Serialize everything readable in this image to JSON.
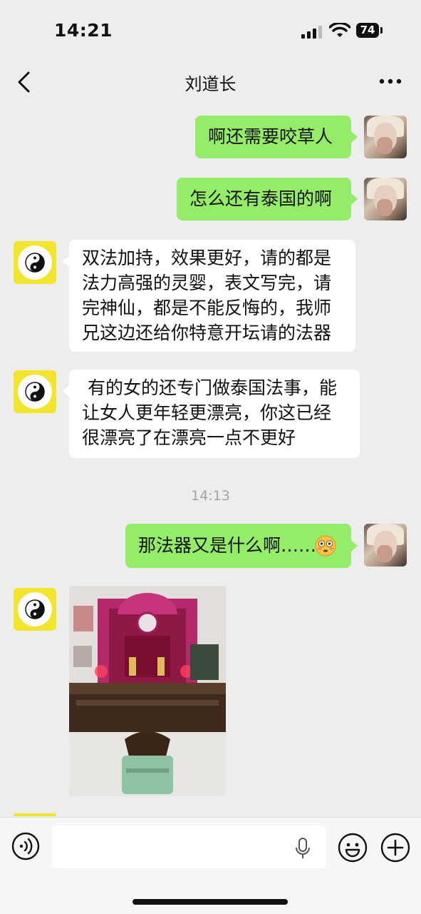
{
  "status_bar": {
    "time": "14:21",
    "battery": "74"
  },
  "header": {
    "title": "刘道长"
  },
  "messages": [
    {
      "sender": "me",
      "text": "啊还需要咬草人"
    },
    {
      "sender": "me",
      "text": "怎么还有泰国的啊"
    },
    {
      "sender": "contact",
      "text": "双法加持，效果更好，请的都是\n法力高强的灵婴，表文写完，请\n完神仙，都是不能反悔的，我师\n兄这边还给你特意开坛请的法器"
    },
    {
      "sender": "contact",
      "text": " 有的女的还专门做泰国法事，能\n让女人更年轻更漂亮，你这已经\n很漂亮了在漂亮一点不更好"
    },
    {
      "sender": "me",
      "text": "那法器又是什么啊……",
      "emoji": "flushed-face-icon"
    },
    {
      "sender": "contact",
      "type": "image",
      "content": "altar-photo"
    }
  ],
  "timestamp": "14:13",
  "input": {
    "value": "",
    "placeholder": ""
  },
  "colors": {
    "outgoing_bubble": "#95ec69",
    "incoming_bubble": "#ffffff",
    "background": "#ededed",
    "contact_avatar": "#f3e52d"
  }
}
